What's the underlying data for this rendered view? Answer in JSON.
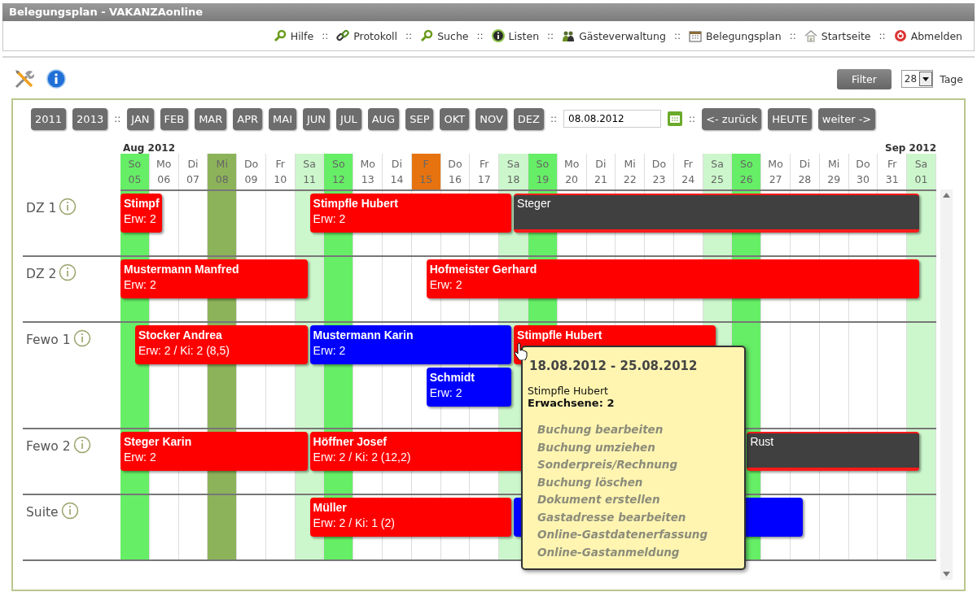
{
  "window": {
    "title": "Belegungsplan - VAKANZAonline"
  },
  "nav": {
    "separator": "::",
    "items": [
      {
        "label": "Hilfe"
      },
      {
        "label": "Protokoll"
      },
      {
        "label": "Suche"
      },
      {
        "label": "Listen"
      },
      {
        "label": "Gästeverwaltung"
      },
      {
        "label": "Belegungsplan"
      },
      {
        "label": "Startseite"
      },
      {
        "label": "Abmelden"
      }
    ]
  },
  "toolbar": {
    "filter_button": "Filter",
    "days_select": {
      "value": "28"
    },
    "days_label": "Tage"
  },
  "calendar": {
    "separator": "::",
    "year_buttons": [
      "2011",
      "2013"
    ],
    "month_buttons": [
      "JAN",
      "FEB",
      "MAR",
      "APR",
      "MAI",
      "JUN",
      "JUL",
      "AUG",
      "SEP",
      "OKT",
      "NOV",
      "DEZ"
    ],
    "date_field": {
      "value": "08.08.2012"
    },
    "nav_buttons": [
      "<- zurück",
      "HEUTE",
      "weiter ->"
    ],
    "days": [
      {
        "weekday": "So",
        "day": "05",
        "kind": "sunday",
        "month": "Aug 2012"
      },
      {
        "weekday": "Mo",
        "day": "06",
        "kind": "weekday"
      },
      {
        "weekday": "Di",
        "day": "07",
        "kind": "weekday"
      },
      {
        "weekday": "Mi",
        "day": "08",
        "kind": "today"
      },
      {
        "weekday": "Do",
        "day": "09",
        "kind": "weekday"
      },
      {
        "weekday": "Fr",
        "day": "10",
        "kind": "weekday"
      },
      {
        "weekday": "Sa",
        "day": "11",
        "kind": "saturday"
      },
      {
        "weekday": "So",
        "day": "12",
        "kind": "sunday"
      },
      {
        "weekday": "Mo",
        "day": "13",
        "kind": "weekday"
      },
      {
        "weekday": "Di",
        "day": "14",
        "kind": "weekday"
      },
      {
        "weekday": "F",
        "day": "15",
        "kind": "holiday"
      },
      {
        "weekday": "Do",
        "day": "16",
        "kind": "weekday"
      },
      {
        "weekday": "Fr",
        "day": "17",
        "kind": "weekday"
      },
      {
        "weekday": "Sa",
        "day": "18",
        "kind": "saturday"
      },
      {
        "weekday": "So",
        "day": "19",
        "kind": "sunday"
      },
      {
        "weekday": "Mo",
        "day": "20",
        "kind": "weekday"
      },
      {
        "weekday": "Di",
        "day": "21",
        "kind": "weekday"
      },
      {
        "weekday": "Mi",
        "day": "22",
        "kind": "weekday"
      },
      {
        "weekday": "Do",
        "day": "23",
        "kind": "weekday"
      },
      {
        "weekday": "Fr",
        "day": "24",
        "kind": "weekday"
      },
      {
        "weekday": "Sa",
        "day": "25",
        "kind": "saturday"
      },
      {
        "weekday": "So",
        "day": "26",
        "kind": "sunday"
      },
      {
        "weekday": "Mo",
        "day": "27",
        "kind": "weekday"
      },
      {
        "weekday": "Di",
        "day": "28",
        "kind": "weekday"
      },
      {
        "weekday": "Mi",
        "day": "29",
        "kind": "weekday"
      },
      {
        "weekday": "Do",
        "day": "30",
        "kind": "weekday"
      },
      {
        "weekday": "Fr",
        "day": "31",
        "kind": "weekday"
      },
      {
        "weekday": "Sa",
        "day": "01",
        "kind": "saturday",
        "month": "Sep 2012"
      }
    ],
    "rooms": [
      {
        "name": "DZ 1",
        "bookings": [
          {
            "kind": "booking",
            "color": "#ff0000",
            "name": "Stimpf",
            "info": "Erw: 2"
          },
          {
            "kind": "booking",
            "color": "#ff0000",
            "name": "Stimpfle Hubert",
            "info": "Erw: 2"
          },
          {
            "kind": "block",
            "color": "#404040",
            "name": "Steger"
          }
        ]
      },
      {
        "name": "DZ 2",
        "bookings": [
          {
            "kind": "booking",
            "color": "#ff0000",
            "name": "Mustermann Manfred",
            "info": "Erw: 2"
          },
          {
            "kind": "booking",
            "color": "#ff0000",
            "name": "Hofmeister Gerhard",
            "info": "Erw: 2"
          }
        ]
      },
      {
        "name": "Fewo 1",
        "bookings": [
          {
            "kind": "booking",
            "color": "#ff0000",
            "name": "Stocker Andrea",
            "info": "Erw: 2 / Ki: 2 (8,5)"
          },
          {
            "kind": "booking",
            "color": "#0000ff",
            "name": "Mustermann Karin",
            "info": "Erw: 2"
          },
          {
            "kind": "booking",
            "color": "#0000ff",
            "name": "Schmidt",
            "info": "Erw: 2"
          },
          {
            "kind": "booking",
            "color": "#ff0000",
            "name": "Stimpfle Hubert"
          }
        ]
      },
      {
        "name": "Fewo 2",
        "bookings": [
          {
            "kind": "booking",
            "color": "#ff0000",
            "name": "Steger Karin",
            "info": "Erw: 2"
          },
          {
            "kind": "booking",
            "color": "#ff0000",
            "name": "Höffner Josef",
            "info": "Erw: 2 / Ki: 2 (12,2)"
          },
          {
            "kind": "block",
            "color": "#404040",
            "name": "Rust"
          }
        ]
      },
      {
        "name": "Suite",
        "bookings": [
          {
            "kind": "booking",
            "color": "#ff0000",
            "name": "Müller",
            "info": "Erw: 2 / Ki: 1 (2)"
          },
          {
            "kind": "booking",
            "color": "#0000ff"
          }
        ]
      }
    ],
    "tooltip": {
      "dates": "18.08.2012 - 25.08.2012",
      "guest": "Stimpfle Hubert",
      "adults": "Erwachsene: 2",
      "actions": [
        "Buchung bearbeiten",
        "Buchung umziehen",
        "Sonderpreis/Rechnung",
        "Buchung löschen",
        "Dokument erstellen",
        "Gastadresse bearbeiten",
        "Online-Gastdatenerfassung",
        "Online-Gastanmeldung"
      ]
    }
  }
}
